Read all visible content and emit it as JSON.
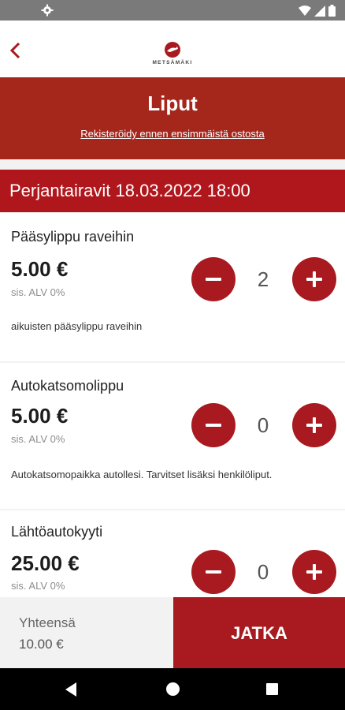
{
  "colors": {
    "accent": "#a81a1f",
    "hero": "#a5271c",
    "background": "#f2f2f2"
  },
  "statusbar": {
    "left_icon": "gear-icon",
    "right_icons": [
      "wifi-icon",
      "signal-icon",
      "battery-icon"
    ]
  },
  "appbar": {
    "back_icon": "chevron-left-icon",
    "logo_text": "METSÄMÄKI"
  },
  "hero": {
    "title": "Liput",
    "register_link": "Rekisteröidy ennen ensimmäistä ostosta"
  },
  "event": {
    "title": "Perjantairavit 18.03.2022 18:00"
  },
  "tickets": [
    {
      "name": "Pääsylippu raveihin",
      "price": "5.00 €",
      "vat": "sis. ALV 0%",
      "quantity": "2",
      "description": "aikuisten pääsylippu raveihin"
    },
    {
      "name": "Autokatsomolippu",
      "price": "5.00 €",
      "vat": "sis. ALV 0%",
      "quantity": "0",
      "description": "Autokatsomopaikka autollesi. Tarvitset lisäksi henkilöliput."
    },
    {
      "name": "Lähtöautokyyti",
      "price": "25.00 €",
      "vat": "sis. ALV 0%",
      "quantity": "0",
      "description": ""
    }
  ],
  "footer": {
    "total_label": "Yhteensä",
    "total_value": "10.00 €",
    "continue_label": "JATKA"
  },
  "navbar": {
    "icons": [
      "back-triangle-icon",
      "home-circle-icon",
      "recents-square-icon"
    ]
  }
}
